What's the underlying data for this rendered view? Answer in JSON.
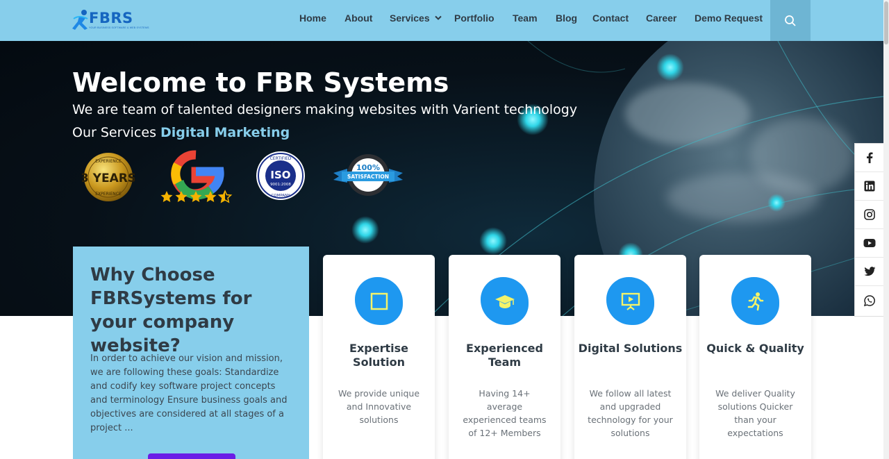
{
  "header": {
    "logo_text": "FBRS",
    "logo_tagline": "YOUR BUSINESS SOFTWARE & WEB SYSTEMS",
    "nav": [
      {
        "label": "Home"
      },
      {
        "label": "About"
      },
      {
        "label": "Services"
      },
      {
        "label": "Portfolio"
      },
      {
        "label": "Team"
      },
      {
        "label": "Blog"
      },
      {
        "label": "Contact"
      },
      {
        "label": "Career"
      },
      {
        "label": "Demo Request"
      }
    ],
    "search_icon": "search-icon"
  },
  "hero": {
    "title": "Welcome to FBR Systems",
    "subtitle": "We are team of talented designers making websites with Varient technology",
    "services_prefix": "Our Services",
    "services_highlight": "Digital Marketing",
    "badges": {
      "experience_line1": "EXPERIENCE",
      "experience_main": "3 YEARS",
      "experience_line2": "EXPERIENCE",
      "google_rating": 4.5,
      "iso_top": "CERTIFIED",
      "iso_main": "ISO",
      "iso_number": "9001:2008",
      "iso_bottom": "COMPANY",
      "satisfaction_main": "100%",
      "satisfaction_label": "SATISFACTION"
    }
  },
  "social": [
    "facebook-icon",
    "linkedin-icon",
    "instagram-icon",
    "youtube-icon",
    "twitter-icon",
    "whatsapp-icon"
  ],
  "why": {
    "title": "Why Choose FBRSystems for your company website?",
    "text": "In order to achieve our vision and mission, we are following these goals: Standardize and codify key software project concepts and terminology Ensure business goals and objectives are considered at all stages of a project ..."
  },
  "cards": [
    {
      "icon": "square-icon",
      "title": "Expertise Solution",
      "text": "We provide unique and Innovative solutions"
    },
    {
      "icon": "graduation-cap-icon",
      "title": "Experienced Team",
      "text": "Having 14+ average experienced teams of 12+ Members"
    },
    {
      "icon": "presentation-icon",
      "title": "Digital Solutions",
      "text": "We follow all latest and upgraded technology for your solutions"
    },
    {
      "icon": "running-icon",
      "title": "Quick & Quality",
      "text": "We deliver Quality solutions Quicker than your expectations"
    }
  ],
  "colors": {
    "header_bg": "#87ceeb",
    "accent_blue": "#1e98f0",
    "purple_button": "#6a1de6",
    "hero_bg": "#071018"
  }
}
